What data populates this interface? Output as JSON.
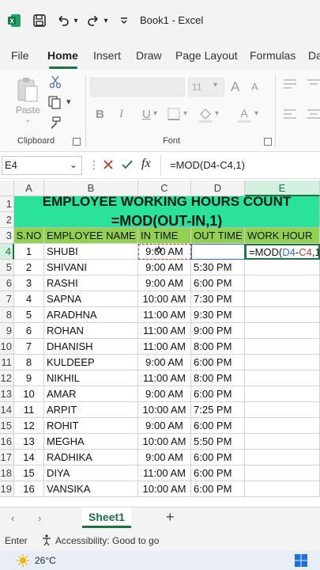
{
  "titlebar": {
    "title": "Book1  -  Excel"
  },
  "tabs": [
    "File",
    "Home",
    "Insert",
    "Draw",
    "Page Layout",
    "Formulas",
    "Da"
  ],
  "ribbon": {
    "paste_label": "Paste",
    "clipboard_label": "Clipboard",
    "font_label": "Font",
    "font_size": "11",
    "bold": "B",
    "italic": "I",
    "underline": "U",
    "grow_font": "A",
    "shrink_font": "A"
  },
  "formula_bar": {
    "name_box": "E4",
    "fx": "fx",
    "formula": "=MOD(D4-C4,1)"
  },
  "columns": [
    "A",
    "B",
    "C",
    "D",
    "E"
  ],
  "title_block": {
    "line1": "EMPLOYEE WORKING HOURS COUNT",
    "line2": "=MOD(OUT-IN,1)"
  },
  "headers": [
    "S.NO",
    "EMPLOYEE NAME",
    "IN TIME",
    "OUT TIME",
    "WORK HOUR"
  ],
  "row_numbers": [
    "1",
    "2",
    "3",
    "4",
    "5",
    "6",
    "7",
    "8",
    "9",
    "10",
    "11",
    "12",
    "13",
    "14",
    "15",
    "16",
    "17",
    "18",
    "19"
  ],
  "rows": [
    [
      "1",
      "SHUBI",
      "9:00 AM",
      ""
    ],
    [
      "2",
      "SHIVANI",
      "9:00 AM",
      "5:30 PM"
    ],
    [
      "3",
      "RASHI",
      "9:00 AM",
      "6:00 PM"
    ],
    [
      "4",
      "SAPNA",
      "10:00 AM",
      "7:30 PM"
    ],
    [
      "5",
      "ARADHNA",
      "11:00 AM",
      "9:30 PM"
    ],
    [
      "6",
      "ROHAN",
      "11:00 AM",
      "9:00 PM"
    ],
    [
      "7",
      "DHANISH",
      "11:00 AM",
      "8:00 PM"
    ],
    [
      "8",
      "KULDEEP",
      "9:00 AM",
      "6:00 PM"
    ],
    [
      "9",
      "NIKHIL",
      "11:00 AM",
      "8:00 PM"
    ],
    [
      "10",
      "AMAR",
      "9:00 AM",
      "6:00 PM"
    ],
    [
      "11",
      "ARPIT",
      "10:00 AM",
      "7:25 PM"
    ],
    [
      "12",
      "ROHIT",
      "9:00 AM",
      "6:00 PM"
    ],
    [
      "13",
      "MEGHA",
      "10:00 AM",
      "5:50 PM"
    ],
    [
      "14",
      "RADHIKA",
      "9:00 AM",
      "6:00 PM"
    ],
    [
      "15",
      "DIYA",
      "11:00 AM",
      "6:00 PM"
    ],
    [
      "16",
      "VANSIKA",
      "10:00 AM",
      "6:00 PM"
    ]
  ],
  "active_cell_edit": {
    "prefix": "=MOD(",
    "ref1": "D4",
    "minus": "-",
    "ref2": "C4",
    "suffix": ",1)"
  },
  "sheet_tab": "Sheet1",
  "status": {
    "mode": "Enter",
    "accessibility": "Accessibility: Good to go"
  },
  "taskbar": {
    "temperature": "26°C"
  },
  "colors": {
    "accent": "#1e7145",
    "title_fill": "#2be29a",
    "header_fill": "#92d050",
    "ref_d": "#2f6fd8",
    "ref_c": "#c0392b"
  }
}
